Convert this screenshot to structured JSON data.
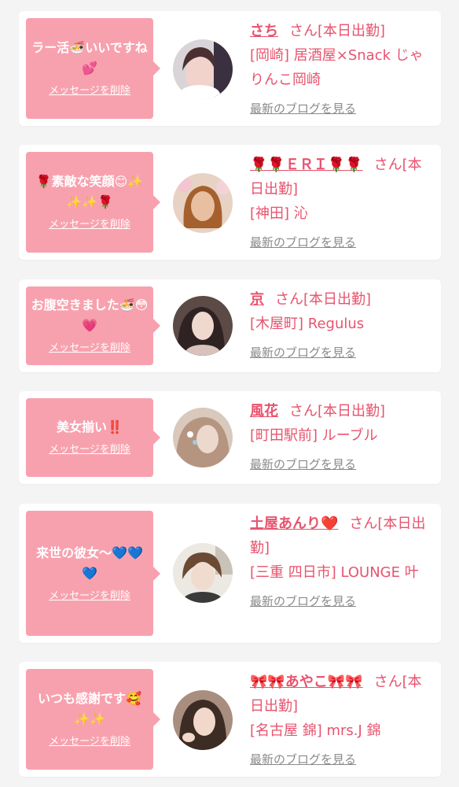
{
  "colors": {
    "accent": "#e8536e",
    "bubble": "#f8a1ae",
    "background": "#f4f4f4"
  },
  "delete_label": "メッセージを削除",
  "blog_label": "最新のブログを見る",
  "san_label": "さん",
  "cards": [
    {
      "message": "ラー活🍜いいですね💕",
      "name": "さち",
      "status": "[本日出勤]",
      "location": "[岡崎] 居酒屋×Snack じゃりんこ岡崎"
    },
    {
      "message": "🌹素敵な笑顔😊✨✨✨🌹",
      "name": "🌹🌹ＥＲＩ🌹🌹",
      "status": "[本日出勤]",
      "location": "[神田] 沁"
    },
    {
      "message": "お腹空きました🍜😳💗",
      "name": "京",
      "status": "[本日出勤]",
      "location": "[木屋町] Regulus"
    },
    {
      "message": "美女揃い‼️",
      "name": "風花",
      "status": "[本日出勤]",
      "location": "[町田駅前] ルーブル"
    },
    {
      "message": "来世の彼女〜💙💙💙",
      "name": "土屋あんり❤️",
      "status": "[本日出勤]",
      "location": "[三重 四日市] LOUNGE 叶"
    },
    {
      "message": "いつも感謝です🥰✨✨",
      "name": "🎀🎀あやこ🎀🎀",
      "status": "[本日出勤]",
      "location": "[名古屋 錦] mrs.J 錦"
    }
  ]
}
